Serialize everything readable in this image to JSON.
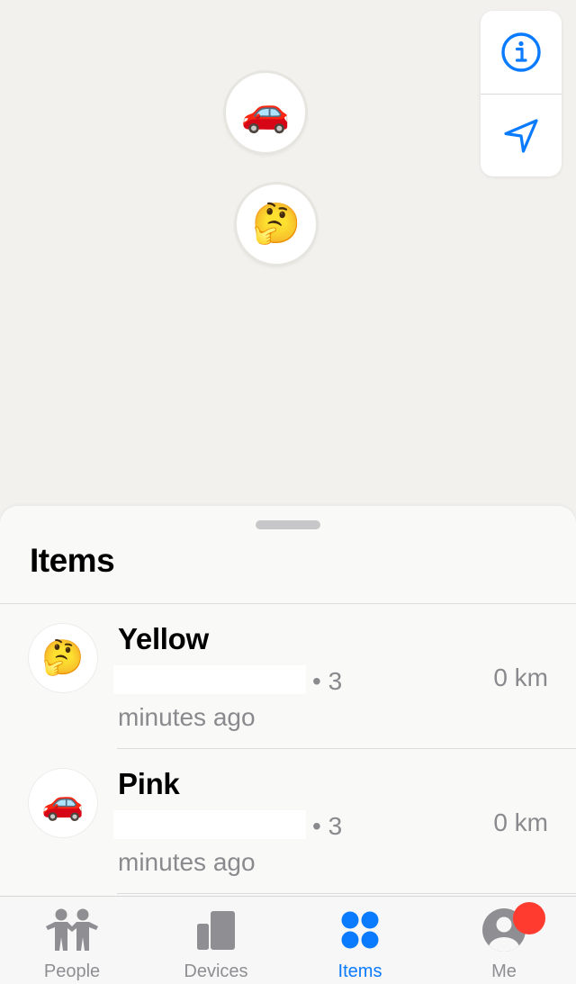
{
  "map": {
    "pins": [
      {
        "name": "car-pin",
        "emoji": "🚗"
      },
      {
        "name": "thinking-face-pin",
        "emoji": "🤔"
      }
    ],
    "controls": {
      "info_icon": "info-icon",
      "location_icon": "location-arrow-icon"
    }
  },
  "sheet": {
    "title": "Items",
    "items": [
      {
        "name": "Yellow",
        "emoji": "🤔",
        "time": "• 3 minutes ago",
        "distance": "0 km"
      },
      {
        "name": "Pink",
        "emoji": "🚗",
        "time": "• 3 minutes ago",
        "distance": "0 km"
      }
    ]
  },
  "tabbar": {
    "tabs": [
      {
        "label": "People",
        "icon": "people-icon",
        "active": false
      },
      {
        "label": "Devices",
        "icon": "devices-icon",
        "active": false
      },
      {
        "label": "Items",
        "icon": "items-icon",
        "active": true
      },
      {
        "label": "Me",
        "icon": "me-icon",
        "active": false
      }
    ]
  },
  "colors": {
    "accent": "#0a7aff",
    "inactive": "#8e8e93",
    "badge": "#ff3b30"
  }
}
